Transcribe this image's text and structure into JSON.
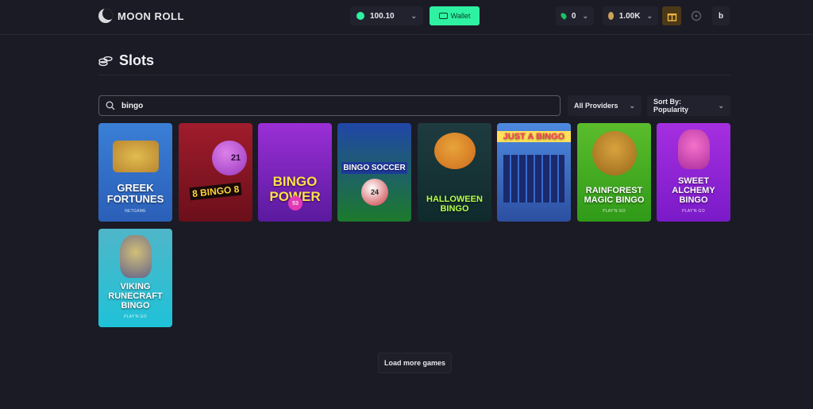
{
  "header": {
    "logo_text": "MOON ROLL",
    "balance": "100.10",
    "wallet_label": "Wallet",
    "gems": "0",
    "coins": "1.00K",
    "user_initial": "b"
  },
  "page": {
    "title": "Slots"
  },
  "filters": {
    "search_value": "bingo",
    "providers_label": "All Providers",
    "sort_label": "Sort By: Popularity"
  },
  "games": [
    {
      "title": "Greek Fortunes",
      "sub": "NETGAME",
      "bg": "linear-gradient(180deg,#3a7fd6 0%,#2b5fb8 100%)"
    },
    {
      "title": "",
      "title_art": "8 BINGO 8",
      "ball": "21",
      "sub": "",
      "bg": "linear-gradient(180deg,#a01c2c 0%,#6b0f1a 100%)"
    },
    {
      "title": "",
      "title_art": "BINGO POWER",
      "ball": "53",
      "sub": "",
      "bg": "linear-gradient(180deg,#9b2fd6 0%,#5a1a9e 100%)"
    },
    {
      "title": "",
      "title_art": "BINGO SOCCER",
      "ball": "24",
      "sub": "",
      "bg": "linear-gradient(180deg,#2046a8 0%,#1c7a2c 100%)"
    },
    {
      "title": "",
      "title_art": "HALLOWEEN BINGO",
      "ball": "",
      "sub": "",
      "bg": "linear-gradient(180deg,#1e3c40 0%,#0f2a2c 100%)"
    },
    {
      "title": "",
      "title_art": "JUST A BINGO",
      "ball": "",
      "sub": "",
      "bg": "linear-gradient(180deg,#4d8ae0 0%,#2c4fa0 100%)"
    },
    {
      "title": "Rainforest Magic Bingo",
      "sub": "PLAY'N GO",
      "bg": "linear-gradient(180deg,#5bbd2c 0%,#2f9a18 100%)"
    },
    {
      "title": "Sweet Alchemy Bingo",
      "sub": "PLAY'N GO",
      "bg": "linear-gradient(180deg,#a52fe0 0%,#7a1ac8 100%)"
    },
    {
      "title": "Viking Runecraft Bingo",
      "sub": "PLAY'N GO",
      "bg": "linear-gradient(180deg,#4fb6c8 0%,#1fc2d8 100%)"
    }
  ],
  "load_more_label": "Load more games",
  "colors": {
    "accent": "#2ef2a2",
    "background": "#1b1b25",
    "panel": "#22222e"
  }
}
